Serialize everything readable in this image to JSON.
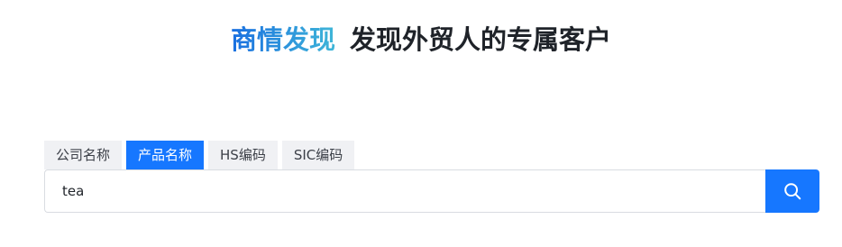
{
  "hero": {
    "brand": "商情发现",
    "tagline": "发现外贸人的专属客户"
  },
  "tabs": [
    {
      "label": "公司名称",
      "active": false
    },
    {
      "label": "产品名称",
      "active": true
    },
    {
      "label": "HS编码",
      "active": false
    },
    {
      "label": "SIC编码",
      "active": false
    }
  ],
  "search": {
    "value": "tea",
    "button_icon": "search-icon"
  },
  "colors": {
    "accent": "#1677ff",
    "brand_gradient_start": "#1a6fe0",
    "brand_gradient_end": "#3fb6d8",
    "tab_inactive_bg": "#f0f1f4"
  }
}
